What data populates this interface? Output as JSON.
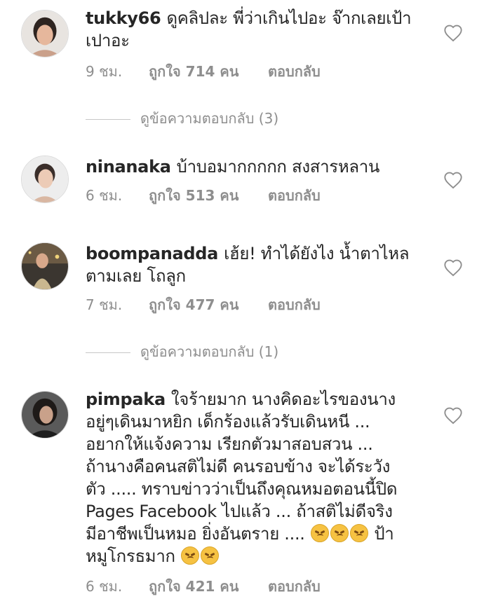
{
  "comments": [
    {
      "username": "tukky66",
      "text": "ดูคลิปละ พี่ว่าเกินไปอะ จ๊ากเลยเป้าเปาอะ",
      "time": "9 ชม.",
      "likes": "ถูกใจ 714 คน",
      "reply": "ตอบกลับ",
      "view_replies": "ดูข้อความตอบกลับ (3)"
    },
    {
      "username": "ninanaka",
      "text": "บ้าบอมากกกกก สงสารหลาน",
      "time": "6 ชม.",
      "likes": "ถูกใจ 513 คน",
      "reply": "ตอบกลับ"
    },
    {
      "username": "boompanadda",
      "text": "เฮ้ย! ทำได้ยังไง น้ำตาไหลตามเลย โถลูก",
      "time": "7 ชม.",
      "likes": "ถูกใจ 477 คน",
      "reply": "ตอบกลับ",
      "view_replies": "ดูข้อความตอบกลับ (1)"
    },
    {
      "username": "pimpaka",
      "text_lines": [
        "ใจร้ายมาก นางคิดอะไรของนาง",
        "อยู่ๆเดินมาหยิก เด็กร้องแล้วรับเดินหนี ...",
        "อยากให้แจ้งความ เรียกตัวมาสอบสวน ...",
        "ถ้านางคือคนสติไม่ดี คนรอบข้าง จะได้ระวัง",
        "ตัว ..... ทราบข่าวว่าเป็นถึงคุณหมอตอนนี้ปิด",
        "Pages Facebook ไปแล้ว ... ถ้าสติไม่ดีจริง",
        "มีอาชีพเป็นหมอ ยิ่งอันตราย ....",
        "ป้า",
        "หมูโกรธมาก"
      ],
      "time": "6 ชม.",
      "likes": "ถูกใจ 421 คน",
      "reply": "ตอบกลับ"
    }
  ],
  "icons": {
    "like": "heart-outline-icon",
    "emoji": "angry-face-emoji"
  },
  "colors": {
    "text": "#262626",
    "muted": "#8e8e8e",
    "divider": "#c7c7c7",
    "emoji": "#f6c242"
  }
}
